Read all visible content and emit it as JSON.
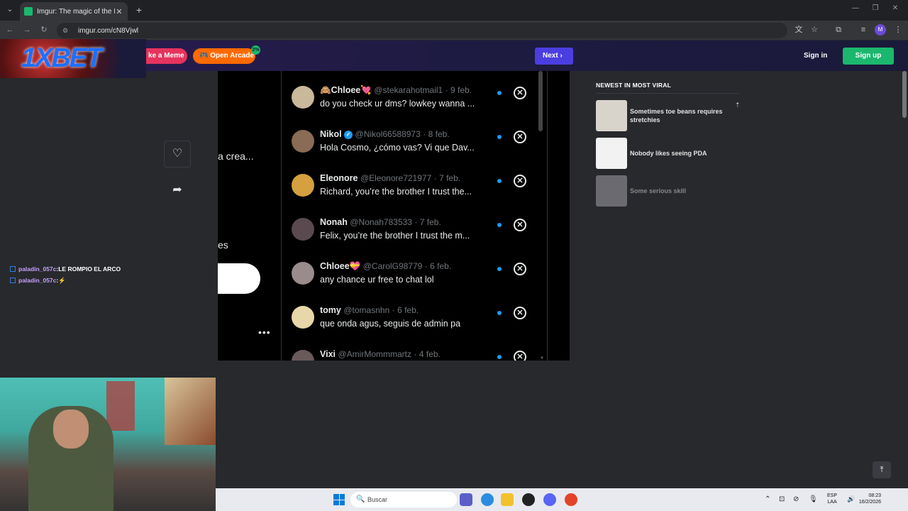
{
  "browser": {
    "tab_title": "Imgur: The magic of the Intern",
    "url": "imgur.com/cN8Vjwl"
  },
  "header": {
    "overlay_logo": "1XBET",
    "meme_button": "ke a Meme",
    "arcade_button": "Open Arcade",
    "arcade_badge": "2%",
    "next_button": "Next",
    "signin": "Sign in",
    "signup": "Sign up"
  },
  "chat": [
    {
      "user": "paladin_057c",
      "sep": " : ",
      "msg": "LE ROMPIO EL ARCO"
    },
    {
      "user": "paladin_057c",
      "sep": " : ",
      "msg": ""
    }
  ],
  "post": {
    "left_text_1": "a crea...",
    "left_text_2": "es",
    "more": "•••"
  },
  "dms": [
    {
      "name": "Chloee",
      "handle": "@stekarahotmail1",
      "date": "· 9 feb.",
      "msg": "do you check ur dms? lowkey wanna ...",
      "avatar": "#c9b89a",
      "prefix": "🙈",
      "suffix": "💘",
      "verified": false
    },
    {
      "name": "Nikol",
      "handle": "@Nikol66588973",
      "date": "· 8 feb.",
      "msg": "Hola Cosmo, ¿cómo vas? Vi que Dav...",
      "avatar": "#8a6b55",
      "prefix": "",
      "suffix": "",
      "verified": true
    },
    {
      "name": "Eleonore",
      "handle": "@Eleonore721977",
      "date": "· 7 feb.",
      "msg": "Richard, you’re the brother I trust the...",
      "avatar": "#d4a040",
      "prefix": "",
      "suffix": "",
      "verified": false
    },
    {
      "name": "Nonah",
      "handle": "@Nonah783533",
      "date": "· 7 feb.",
      "msg": "Felix, you’re the brother I trust the m...",
      "avatar": "#5a4a50",
      "prefix": "",
      "suffix": "",
      "verified": false
    },
    {
      "name": "Chloee",
      "handle": "@CarolG98779",
      "date": "· 6 feb.",
      "msg": "any chance ur free to chat lol",
      "avatar": "#9a8c8c",
      "prefix": "",
      "suffix": "💝",
      "verified": false
    },
    {
      "name": "tomy",
      "handle": "@tomasnhn",
      "date": "· 6 feb.",
      "msg": "que onda agus, seguis de admin pa",
      "avatar": "#e8d7a8",
      "prefix": "",
      "suffix": "",
      "verified": false
    },
    {
      "name": "Vixi",
      "handle": "@AmirMommmartz",
      "date": "· 4 feb.",
      "msg": "",
      "avatar": "#6a5a5a",
      "prefix": "",
      "suffix": "",
      "verified": false
    }
  ],
  "viral": {
    "title": "NEWEST IN MOST VIRAL",
    "items": [
      {
        "text": "Sometimes toe beans requires stretchies",
        "thumb": "#d8d4cc"
      },
      {
        "text": "Nobody likes seeing PDA",
        "thumb": "#f2f2f2"
      },
      {
        "text": "Some serious skill",
        "thumb": "#6a6a70"
      }
    ]
  },
  "taskbar": {
    "search_placeholder": "Buscar",
    "lang_1": "ESP",
    "lang_2": "LAA",
    "time": "08:23",
    "date": "16/2/2026"
  },
  "colors": {
    "accent_purple": "#4b3ee0",
    "signup_green": "#1bb76e",
    "arcade_orange": "#ff6a00",
    "meme_pink": "#e6335d",
    "unread_blue": "#1d9bf0"
  }
}
